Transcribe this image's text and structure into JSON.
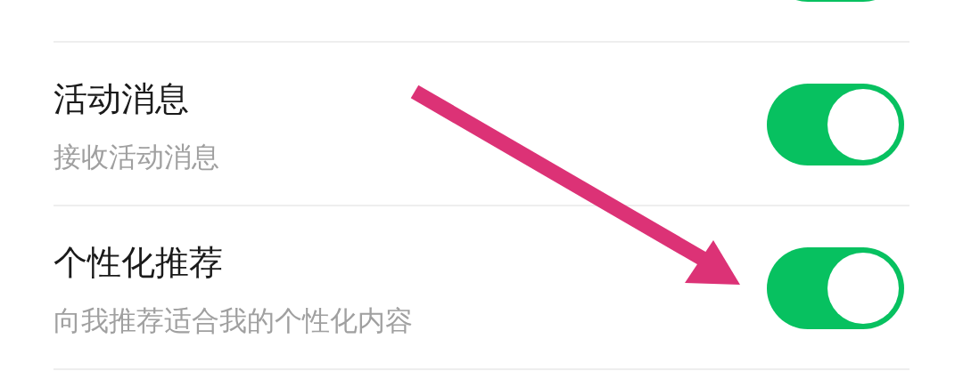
{
  "cut_row": {
    "on": true
  },
  "settings": [
    {
      "title": "活动消息",
      "subtitle": "接收活动消息",
      "on": true
    },
    {
      "title": "个性化推荐",
      "subtitle": "向我推荐适合我的个性化内容",
      "on": true
    }
  ]
}
